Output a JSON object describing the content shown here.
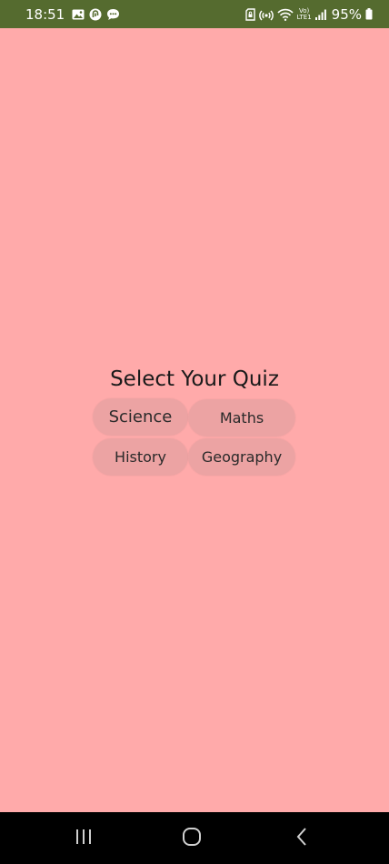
{
  "status_bar": {
    "time": "18:51",
    "battery_percent": "95%",
    "background_color": "#556b2f",
    "icons_left": [
      "gallery-icon",
      "app-notification-icon",
      "chat-bubble-icon"
    ],
    "icons_right": [
      "sim-lock-icon",
      "hotspot-icon",
      "wifi-icon",
      "volte-icon",
      "signal-icon",
      "battery-icon"
    ],
    "volte_label_top": "Vo)",
    "volte_label_bottom": "LTE1"
  },
  "screen": {
    "background_color": "#ffaaaa",
    "title": "Select Your Quiz",
    "buttons": [
      {
        "label": "Science"
      },
      {
        "label": "Maths"
      },
      {
        "label": "History"
      },
      {
        "label": "Geography"
      }
    ],
    "button_color": "#eca3a3"
  },
  "nav_bar": {
    "items": [
      "recents-icon",
      "home-icon",
      "back-icon"
    ]
  }
}
